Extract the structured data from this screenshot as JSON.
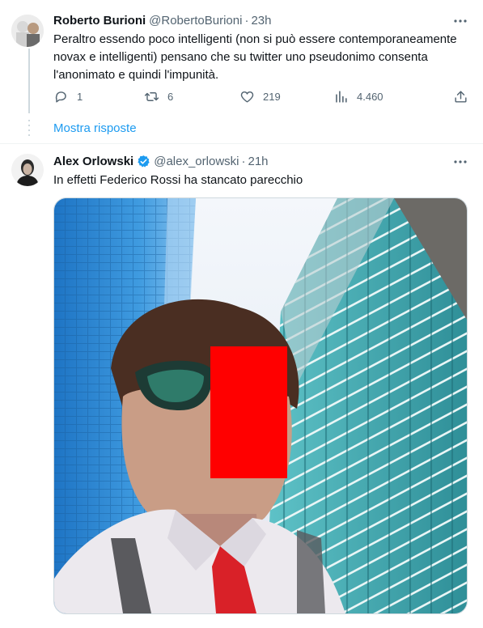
{
  "tweet1": {
    "name": "Roberto Burioni",
    "handle": "@RobertoBurioni",
    "time": "23h",
    "text": "Peraltro essendo poco intelligenti (non si può essere contemporaneamente novax e intelligenti) pensano che su twitter uno pseudonimo consenta l'anonimato e quindi l'impunità.",
    "replies": "1",
    "retweets": "6",
    "likes": "219",
    "views": "4.460",
    "show_replies": "Mostra risposte"
  },
  "tweet2": {
    "name": "Alex Orlowski",
    "handle": "@alex_orlowski",
    "time": "21h",
    "text": "In effetti Federico Rossi ha stancato parecchio",
    "verified": true
  },
  "colors": {
    "accent": "#1d9bf0",
    "redaction": "#ff0000",
    "secondary_text": "#536471"
  }
}
